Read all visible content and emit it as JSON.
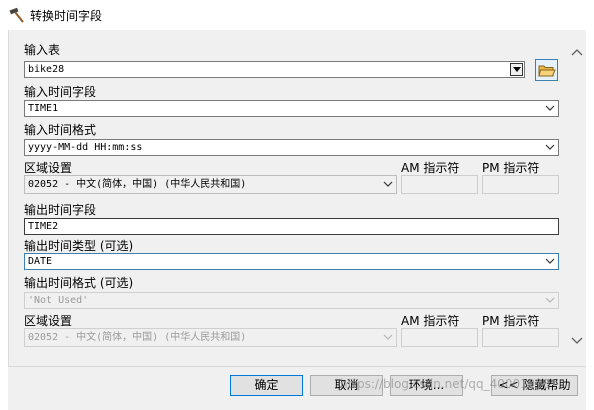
{
  "window": {
    "title": "转换时间字段"
  },
  "input_table": {
    "label": "输入表",
    "value": "bike28"
  },
  "input_time_field": {
    "label": "输入时间字段",
    "value": "TIME1"
  },
  "input_time_format": {
    "label": "输入时间格式",
    "value": "yyyy-MM-dd HH:mm:ss"
  },
  "locale_1": {
    "label": "区域设置",
    "value": "02052 - 中文(简体，中国) (中华人民共和国)",
    "am_label": "AM 指示符",
    "pm_label": "PM 指示符"
  },
  "output_time_field": {
    "label": "输出时间字段",
    "value": "TIME2"
  },
  "output_time_type": {
    "label": "输出时间类型 (可选)",
    "value": "DATE"
  },
  "output_time_format": {
    "label": "输出时间格式 (可选)",
    "value": "'Not Used'"
  },
  "locale_2": {
    "label": "区域设置",
    "value": "02052 - 中文(简体，中国) (中华人民共和国)",
    "am_label": "AM 指示符",
    "pm_label": "PM 指示符"
  },
  "buttons": {
    "ok": "确定",
    "cancel": "取消",
    "env": "环境...",
    "hide_help": "<< 隐藏帮助"
  },
  "watermark": "https://blog.csdn.net/qq_40001298"
}
